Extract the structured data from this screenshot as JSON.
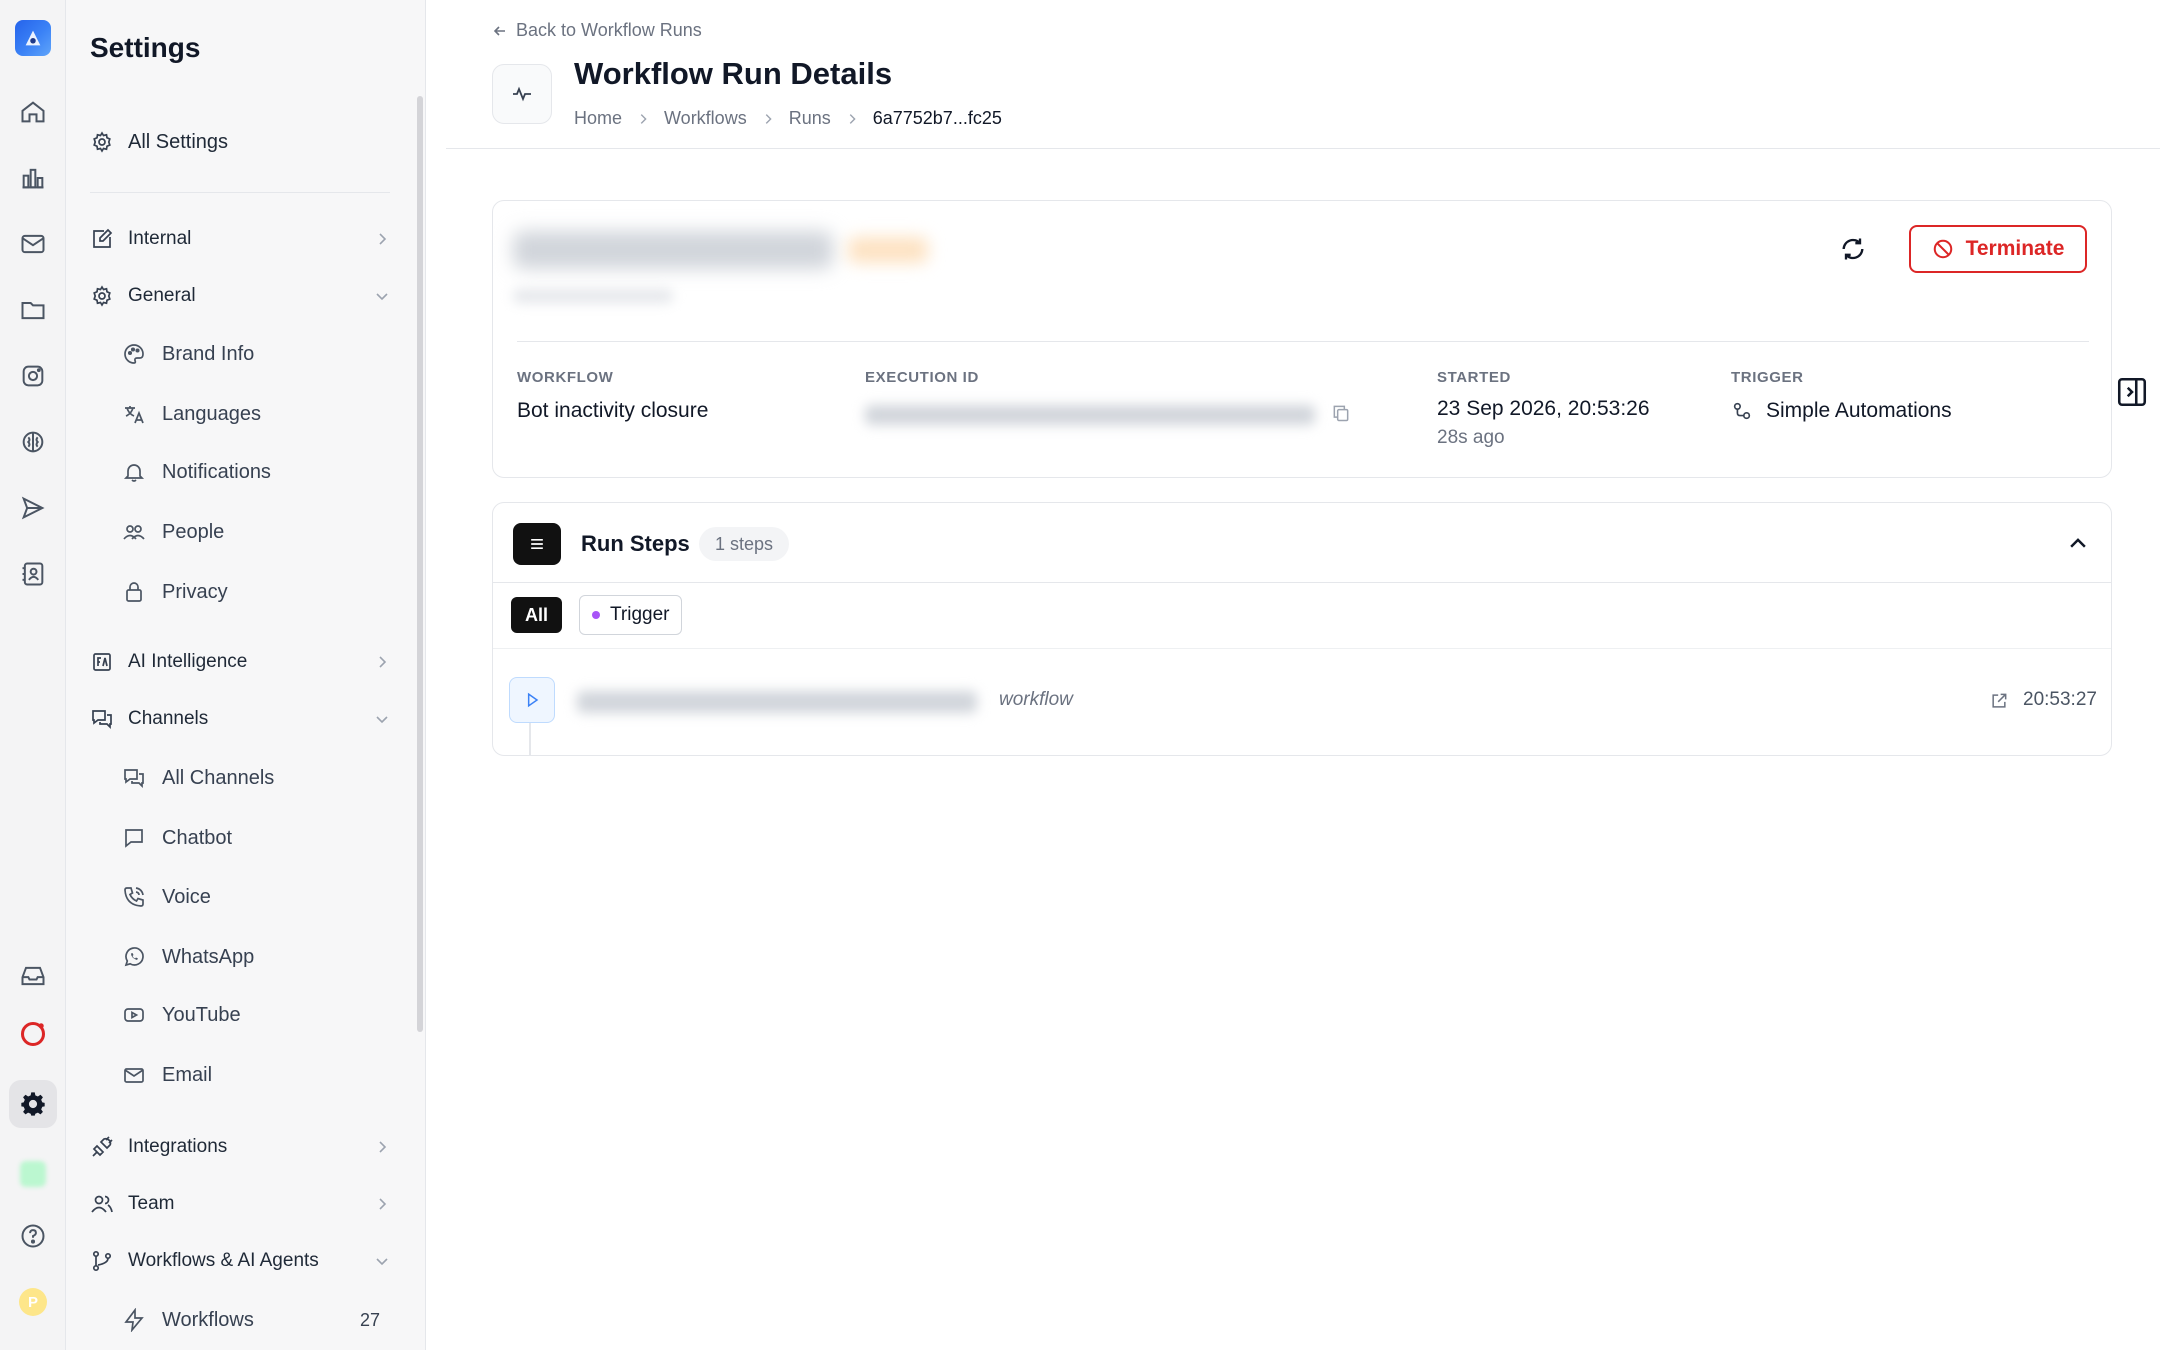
{
  "sidebar": {
    "title": "Settings",
    "all_settings": "All Settings",
    "sections": {
      "internal": "Internal",
      "general": "General",
      "ai_intelligence": "AI Intelligence",
      "channels": "Channels",
      "integrations": "Integrations",
      "team": "Team",
      "workflows_ai_agents": "Workflows & AI Agents"
    },
    "general_items": {
      "brand_info": "Brand Info",
      "languages": "Languages",
      "notifications": "Notifications",
      "people": "People",
      "privacy": "Privacy"
    },
    "channel_items": {
      "all_channels": "All Channels",
      "chatbot": "Chatbot",
      "voice": "Voice",
      "whatsapp": "WhatsApp",
      "youtube": "YouTube",
      "email": "Email"
    },
    "workflow_items": {
      "workflows": "Workflows",
      "workflows_count": "27"
    }
  },
  "header": {
    "back_link": "Back to Workflow Runs",
    "title": "Workflow Run Details",
    "breadcrumb": [
      "Home",
      "Workflows",
      "Runs",
      "6a7752b7...fc25"
    ]
  },
  "run": {
    "terminate_label": "Terminate",
    "workflow_label": "WORKFLOW",
    "workflow_value": "Bot inactivity closure",
    "execution_label": "EXECUTION ID",
    "started_label": "STARTED",
    "started_value": "23 Sep 2026, 20:53:26",
    "started_relative": "28s ago",
    "trigger_label": "TRIGGER",
    "trigger_value": "Simple Automations"
  },
  "steps": {
    "title": "Run Steps",
    "count_badge": "1 steps",
    "filters": {
      "all": "All",
      "trigger": "Trigger"
    },
    "rows": [
      {
        "kind": "workflow",
        "time": "20:53:27"
      }
    ]
  },
  "colors": {
    "accent": "#2563eb",
    "danger": "#dc2626",
    "trigger_dot": "#a855f7"
  }
}
